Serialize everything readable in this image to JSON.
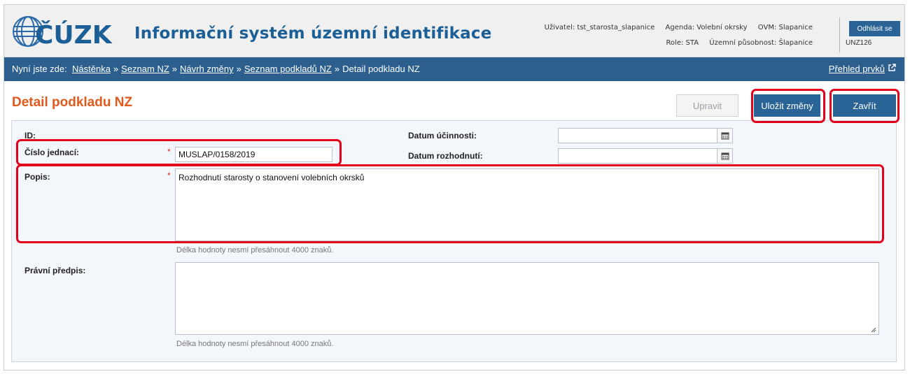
{
  "header": {
    "app_title": "Informační systém územní identifikace",
    "logo_text": "ČÚZK",
    "user": "Uživatel: tst_starosta_slapanice",
    "agenda": "Agenda: Volební okrsky",
    "ovm": "OVM: Slapanice",
    "role": "Role: STA",
    "scope": "Územní působnost: Šlapanice",
    "logout_label": "Odhlásit se",
    "unz_code": "UNZ126"
  },
  "breadcrumb": {
    "prefix": "Nyní jste zde:",
    "items": [
      "Nástěnka",
      "Seznam NZ",
      "Návrh změny",
      "Seznam podkladů NZ"
    ],
    "current": "Detail podkladu NZ",
    "separator": "»",
    "overview_link": "Přehled prvků"
  },
  "page": {
    "title": "Detail podkladu NZ",
    "edit_button": "Upravit",
    "save_button": "Uložit změny",
    "close_button": "Zavřít"
  },
  "form": {
    "id_label": "ID:",
    "id_value": "",
    "number_label": "Číslo jednací:",
    "number_value": "MUSLAP/0158/2019",
    "effective_label": "Datum účinnosti:",
    "effective_value": "",
    "decision_label": "Datum rozhodnutí:",
    "decision_value": "",
    "description_label": "Popis:",
    "description_value": "Rozhodnutí starosty o stanovení volebních okrsků",
    "description_hint": "Délka hodnoty nesmí přesáhnout 4000 znaků.",
    "legal_label": "Právní předpis:",
    "legal_value": "",
    "legal_hint": "Délka hodnoty nesmí přesáhnout 4000 znaků.",
    "required_mark": "*"
  },
  "colors": {
    "brand_blue": "#2a6496",
    "title_orange": "#e05a1b",
    "annotation_red": "#e3001b"
  }
}
